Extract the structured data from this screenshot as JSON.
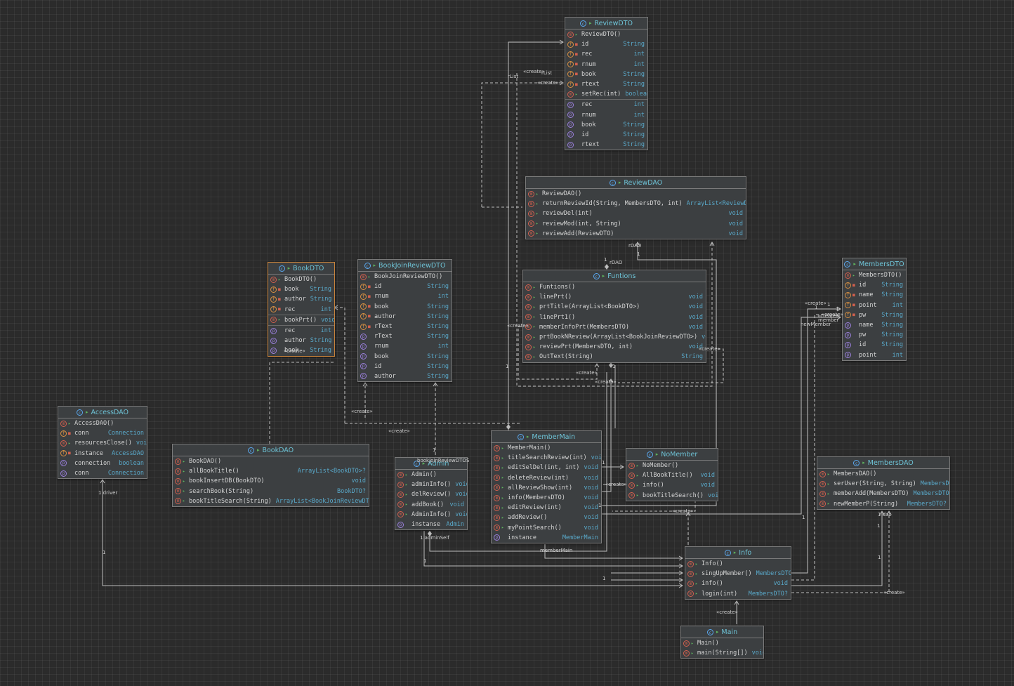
{
  "colors": {
    "background": "#2b2b2b",
    "class_bg": "#3c3f41",
    "class_name": "#6ec3d6",
    "type_text": "#59a8c9",
    "method_mark": "#d2604e",
    "field_mark": "#d99042",
    "property_mark": "#9a7fdb",
    "selection": "#c9833b",
    "edge": "#bdbdbd"
  },
  "icons": {
    "class": "class-circle-icon",
    "pin": "pin-icon",
    "method": "method-circle-icon",
    "field": "field-circle-icon",
    "property": "property-circle-icon",
    "private": "lock-icon",
    "public": "open-lock-icon"
  },
  "classes": [
    {
      "id": "ReviewDTO",
      "name": "ReviewDTO",
      "selected": false,
      "members": [
        {
          "kind": "m",
          "vis": "open",
          "name": "ReviewDTO()",
          "type": ""
        },
        {
          "kind": "f",
          "vis": "lock",
          "name": "id",
          "type": "String"
        },
        {
          "kind": "f",
          "vis": "lock",
          "name": "rec",
          "type": "int"
        },
        {
          "kind": "f",
          "vis": "lock",
          "name": "rnum",
          "type": "int"
        },
        {
          "kind": "f",
          "vis": "lock",
          "name": "book",
          "type": "String"
        },
        {
          "kind": "f",
          "vis": "lock",
          "name": "rtext",
          "type": "String"
        },
        {
          "kind": "m",
          "vis": "open",
          "name": "setRec(int)",
          "type": "boolean"
        },
        {
          "kind": "p",
          "vis": "",
          "name": "rec",
          "type": "int",
          "sep": true
        },
        {
          "kind": "p",
          "vis": "",
          "name": "rnum",
          "type": "int"
        },
        {
          "kind": "p",
          "vis": "",
          "name": "book",
          "type": "String"
        },
        {
          "kind": "p",
          "vis": "",
          "name": "id",
          "type": "String"
        },
        {
          "kind": "p",
          "vis": "",
          "name": "rtext",
          "type": "String"
        }
      ]
    },
    {
      "id": "ReviewDAO",
      "name": "ReviewDAO",
      "selected": false,
      "members": [
        {
          "kind": "m",
          "vis": "open",
          "name": "ReviewDAO()",
          "type": ""
        },
        {
          "kind": "m",
          "vis": "open",
          "name": "returnReviewId(String, MembersDTO, int)",
          "type": "ArrayList<ReviewDTO>"
        },
        {
          "kind": "m",
          "vis": "open",
          "name": "reviewDel(int)",
          "type": "void"
        },
        {
          "kind": "m",
          "vis": "open",
          "name": "reviewMod(int, String)",
          "type": "void"
        },
        {
          "kind": "m",
          "vis": "open",
          "name": "reviewAdd(ReviewDTO)",
          "type": "void"
        }
      ]
    },
    {
      "id": "BookDTO",
      "name": "BookDTO",
      "selected": true,
      "members": [
        {
          "kind": "m",
          "vis": "open",
          "name": "BookDTO()",
          "type": ""
        },
        {
          "kind": "f",
          "vis": "lock",
          "name": "book",
          "type": "String"
        },
        {
          "kind": "f",
          "vis": "lock",
          "name": "author",
          "type": "String"
        },
        {
          "kind": "f",
          "vis": "lock",
          "name": "rec",
          "type": "int"
        },
        {
          "kind": "m",
          "vis": "open",
          "name": "bookPrt()",
          "type": "void",
          "sep": true
        },
        {
          "kind": "p",
          "vis": "",
          "name": "rec",
          "type": "int",
          "sep": true
        },
        {
          "kind": "p",
          "vis": "",
          "name": "author",
          "type": "String"
        },
        {
          "kind": "p",
          "vis": "",
          "name": "book",
          "type": "String"
        }
      ]
    },
    {
      "id": "BookJoinReviewDTO",
      "name": "BookJoinReviewDTO",
      "selected": false,
      "members": [
        {
          "kind": "m",
          "vis": "open",
          "name": "BookJoinReviewDTO()",
          "type": ""
        },
        {
          "kind": "f",
          "vis": "lock",
          "name": "id",
          "type": "String"
        },
        {
          "kind": "f",
          "vis": "lock",
          "name": "rnum",
          "type": "int"
        },
        {
          "kind": "f",
          "vis": "lock",
          "name": "book",
          "type": "String"
        },
        {
          "kind": "f",
          "vis": "lock",
          "name": "author",
          "type": "String"
        },
        {
          "kind": "f",
          "vis": "lock",
          "name": "rText",
          "type": "String"
        },
        {
          "kind": "p",
          "vis": "",
          "name": "rText",
          "type": "String"
        },
        {
          "kind": "p",
          "vis": "",
          "name": "rnum",
          "type": "int"
        },
        {
          "kind": "p",
          "vis": "",
          "name": "book",
          "type": "String"
        },
        {
          "kind": "p",
          "vis": "",
          "name": "id",
          "type": "String"
        },
        {
          "kind": "p",
          "vis": "",
          "name": "author",
          "type": "String"
        }
      ]
    },
    {
      "id": "Funtions",
      "name": "Funtions",
      "selected": false,
      "members": [
        {
          "kind": "m",
          "vis": "open",
          "name": "Funtions()",
          "type": ""
        },
        {
          "kind": "m",
          "vis": "open",
          "name": "linePrt()",
          "type": "void"
        },
        {
          "kind": "m",
          "vis": "open",
          "name": "prtTitle(ArrayList<BookDTO>)",
          "type": "void"
        },
        {
          "kind": "m",
          "vis": "open",
          "name": "linePrt1()",
          "type": "void"
        },
        {
          "kind": "m",
          "vis": "open",
          "name": "memberInfoPrt(MembersDTO)",
          "type": "void"
        },
        {
          "kind": "m",
          "vis": "open",
          "name": "prtBookNReview(ArrayList<BookJoinReviewDTO>)",
          "type": "void"
        },
        {
          "kind": "m",
          "vis": "open",
          "name": "reviewPrt(MembersDTO, int)",
          "type": "void"
        },
        {
          "kind": "m",
          "vis": "open",
          "name": "OutText(String)",
          "type": "String"
        }
      ]
    },
    {
      "id": "MembersDTO",
      "name": "MembersDTO",
      "selected": false,
      "members": [
        {
          "kind": "m",
          "vis": "open",
          "name": "MembersDTO()",
          "type": ""
        },
        {
          "kind": "f",
          "vis": "lock",
          "name": "id",
          "type": "String"
        },
        {
          "kind": "f",
          "vis": "lock",
          "name": "name",
          "type": "String"
        },
        {
          "kind": "f",
          "vis": "lock",
          "name": "point",
          "type": "int"
        },
        {
          "kind": "f",
          "vis": "lock",
          "name": "pw",
          "type": "String"
        },
        {
          "kind": "p",
          "vis": "",
          "name": "name",
          "type": "String"
        },
        {
          "kind": "p",
          "vis": "",
          "name": "pw",
          "type": "String"
        },
        {
          "kind": "p",
          "vis": "",
          "name": "id",
          "type": "String"
        },
        {
          "kind": "p",
          "vis": "",
          "name": "point",
          "type": "int"
        }
      ]
    },
    {
      "id": "AccessDAO",
      "name": "AccessDAO",
      "selected": false,
      "members": [
        {
          "kind": "m",
          "vis": "open",
          "name": "AccessDAO()",
          "type": ""
        },
        {
          "kind": "f",
          "vis": "lock",
          "name": "conn",
          "type": "Connection"
        },
        {
          "kind": "m",
          "vis": "open",
          "name": "resourcesClose()",
          "type": "void"
        },
        {
          "kind": "f",
          "vis": "lock",
          "name": "instance",
          "type": "AccessDAO"
        },
        {
          "kind": "p",
          "vis": "",
          "name": "connection",
          "type": "boolean"
        },
        {
          "kind": "p",
          "vis": "",
          "name": "conn",
          "type": "Connection"
        }
      ]
    },
    {
      "id": "BookDAO",
      "name": "BookDAO",
      "selected": false,
      "members": [
        {
          "kind": "m",
          "vis": "open",
          "name": "BookDAO()",
          "type": ""
        },
        {
          "kind": "m",
          "vis": "open",
          "name": "allBookTitle()",
          "type": "ArrayList<BookDTO>?"
        },
        {
          "kind": "m",
          "vis": "open",
          "name": "bookInsertDB(BookDTO)",
          "type": "void"
        },
        {
          "kind": "m",
          "vis": "open",
          "name": "searchBook(String)",
          "type": "BookDTO?"
        },
        {
          "kind": "m",
          "vis": "open",
          "name": "bookTitleSearch(String)",
          "type": "ArrayList<BookJoinReviewDTO>?"
        }
      ]
    },
    {
      "id": "Admin",
      "name": "Admin",
      "selected": false,
      "members": [
        {
          "kind": "m",
          "vis": "open",
          "name": "Admin()",
          "type": ""
        },
        {
          "kind": "m",
          "vis": "open",
          "name": "adminInfo()",
          "type": "void"
        },
        {
          "kind": "m",
          "vis": "open",
          "name": "delReview()",
          "type": "void"
        },
        {
          "kind": "m",
          "vis": "open",
          "name": "addBook()",
          "type": "void"
        },
        {
          "kind": "m",
          "vis": "open",
          "name": "AdminInfo()",
          "type": "void"
        },
        {
          "kind": "p",
          "vis": "",
          "name": "instanse",
          "type": "Admin"
        }
      ]
    },
    {
      "id": "MemberMain",
      "name": "MemberMain",
      "selected": false,
      "members": [
        {
          "kind": "m",
          "vis": "open",
          "name": "MemberMain()",
          "type": ""
        },
        {
          "kind": "m",
          "vis": "open",
          "name": "titleSearchReview(int)",
          "type": "void"
        },
        {
          "kind": "m",
          "vis": "open",
          "name": "editSelDel(int, int)",
          "type": "void"
        },
        {
          "kind": "m",
          "vis": "open",
          "name": "deleteReview(int)",
          "type": "void"
        },
        {
          "kind": "m",
          "vis": "open",
          "name": "allReviewShow(int)",
          "type": "void"
        },
        {
          "kind": "m",
          "vis": "open",
          "name": "info(MembersDTO)",
          "type": "void"
        },
        {
          "kind": "m",
          "vis": "open",
          "name": "editReview(int)",
          "type": "void"
        },
        {
          "kind": "m",
          "vis": "open",
          "name": "addReview()",
          "type": "void"
        },
        {
          "kind": "m",
          "vis": "open",
          "name": "myPointSearch()",
          "type": "void"
        },
        {
          "kind": "p",
          "vis": "",
          "name": "instance",
          "type": "MemberMain"
        }
      ]
    },
    {
      "id": "NoMember",
      "name": "NoMember",
      "selected": false,
      "members": [
        {
          "kind": "m",
          "vis": "open",
          "name": "NoMember()",
          "type": ""
        },
        {
          "kind": "m",
          "vis": "open",
          "name": "AllBookTitle()",
          "type": "void"
        },
        {
          "kind": "m",
          "vis": "open",
          "name": "info()",
          "type": "void"
        },
        {
          "kind": "m",
          "vis": "open",
          "name": "bookTitleSearch()",
          "type": "void"
        }
      ]
    },
    {
      "id": "MembersDAO",
      "name": "MembersDAO",
      "selected": false,
      "members": [
        {
          "kind": "m",
          "vis": "open",
          "name": "MembersDAO()",
          "type": ""
        },
        {
          "kind": "m",
          "vis": "open",
          "name": "serUser(String, String)",
          "type": "MembersDTO"
        },
        {
          "kind": "m",
          "vis": "open",
          "name": "memberAdd(MembersDTO)",
          "type": "MembersDTO"
        },
        {
          "kind": "m",
          "vis": "open",
          "name": "newMemberP(String)",
          "type": "MembersDTO?"
        }
      ]
    },
    {
      "id": "Info",
      "name": "Info",
      "selected": false,
      "members": [
        {
          "kind": "m",
          "vis": "open",
          "name": "Info()",
          "type": ""
        },
        {
          "kind": "m",
          "vis": "open",
          "name": "singUpMember()",
          "type": "MembersDTO?"
        },
        {
          "kind": "m",
          "vis": "open",
          "name": "info()",
          "type": "void"
        },
        {
          "kind": "m",
          "vis": "open",
          "name": "login(int)",
          "type": "MembersDTO?"
        }
      ]
    },
    {
      "id": "Main",
      "name": "Main",
      "selected": false,
      "members": [
        {
          "kind": "m",
          "vis": "open",
          "name": "Main()",
          "type": ""
        },
        {
          "kind": "m",
          "vis": "open",
          "name": "main(String[])",
          "type": "void"
        }
      ]
    }
  ],
  "edge_labels": [
    {
      "id": "l1",
      "text": "«create»"
    },
    {
      "id": "l2",
      "text": "rList"
    },
    {
      "id": "l3",
      "text": "rList"
    },
    {
      "id": "l4",
      "text": "«create»"
    },
    {
      "id": "l5",
      "text": "1"
    },
    {
      "id": "l6",
      "text": "rDAO"
    },
    {
      "id": "l7",
      "text": "1"
    },
    {
      "id": "l8",
      "text": "rDAO"
    },
    {
      "id": "l9",
      "text": "1"
    },
    {
      "id": "l10",
      "text": "«create»"
    },
    {
      "id": "l11",
      "text": "1"
    },
    {
      "id": "l12",
      "text": "«create»"
    },
    {
      "id": "l13",
      "text": "«create»"
    },
    {
      "id": "l14",
      "text": "«create»"
    },
    {
      "id": "l15",
      "text": "«create»"
    },
    {
      "id": "l16",
      "text": "«create»"
    },
    {
      "id": "l17",
      "text": "1"
    },
    {
      "id": "l18",
      "text": "1"
    },
    {
      "id": "l19",
      "text": "bookJoinReviewDTOS"
    },
    {
      "id": "l20",
      "text": "1"
    },
    {
      "id": "l21",
      "text": "«create»"
    },
    {
      "id": "l22",
      "text": "«create»"
    },
    {
      "id": "l23",
      "text": "1 driver"
    },
    {
      "id": "l24",
      "text": "1"
    },
    {
      "id": "l25",
      "text": "1 adminSelf"
    },
    {
      "id": "l26",
      "text": "1"
    },
    {
      "id": "l27",
      "text": "memberMain"
    },
    {
      "id": "l28",
      "text": "1"
    },
    {
      "id": "l29",
      "text": "1"
    },
    {
      "id": "l30",
      "text": "«create»"
    },
    {
      "id": "l31",
      "text": "«create»"
    },
    {
      "id": "l32",
      "text": "1"
    },
    {
      "id": "l33",
      "text": "1 dao"
    },
    {
      "id": "l34",
      "text": "1"
    },
    {
      "id": "l35",
      "text": "«create»"
    },
    {
      "id": "l36",
      "text": "«create»"
    },
    {
      "id": "l37",
      "text": "1"
    },
    {
      "id": "l38",
      "text": "1"
    },
    {
      "id": "l39",
      "text": "«create»"
    },
    {
      "id": "l40",
      "text": "member"
    },
    {
      "id": "l41",
      "text": "newMember"
    },
    {
      "id": "l42",
      "text": "«create»"
    },
    {
      "id": "l43",
      "text": "1"
    }
  ]
}
